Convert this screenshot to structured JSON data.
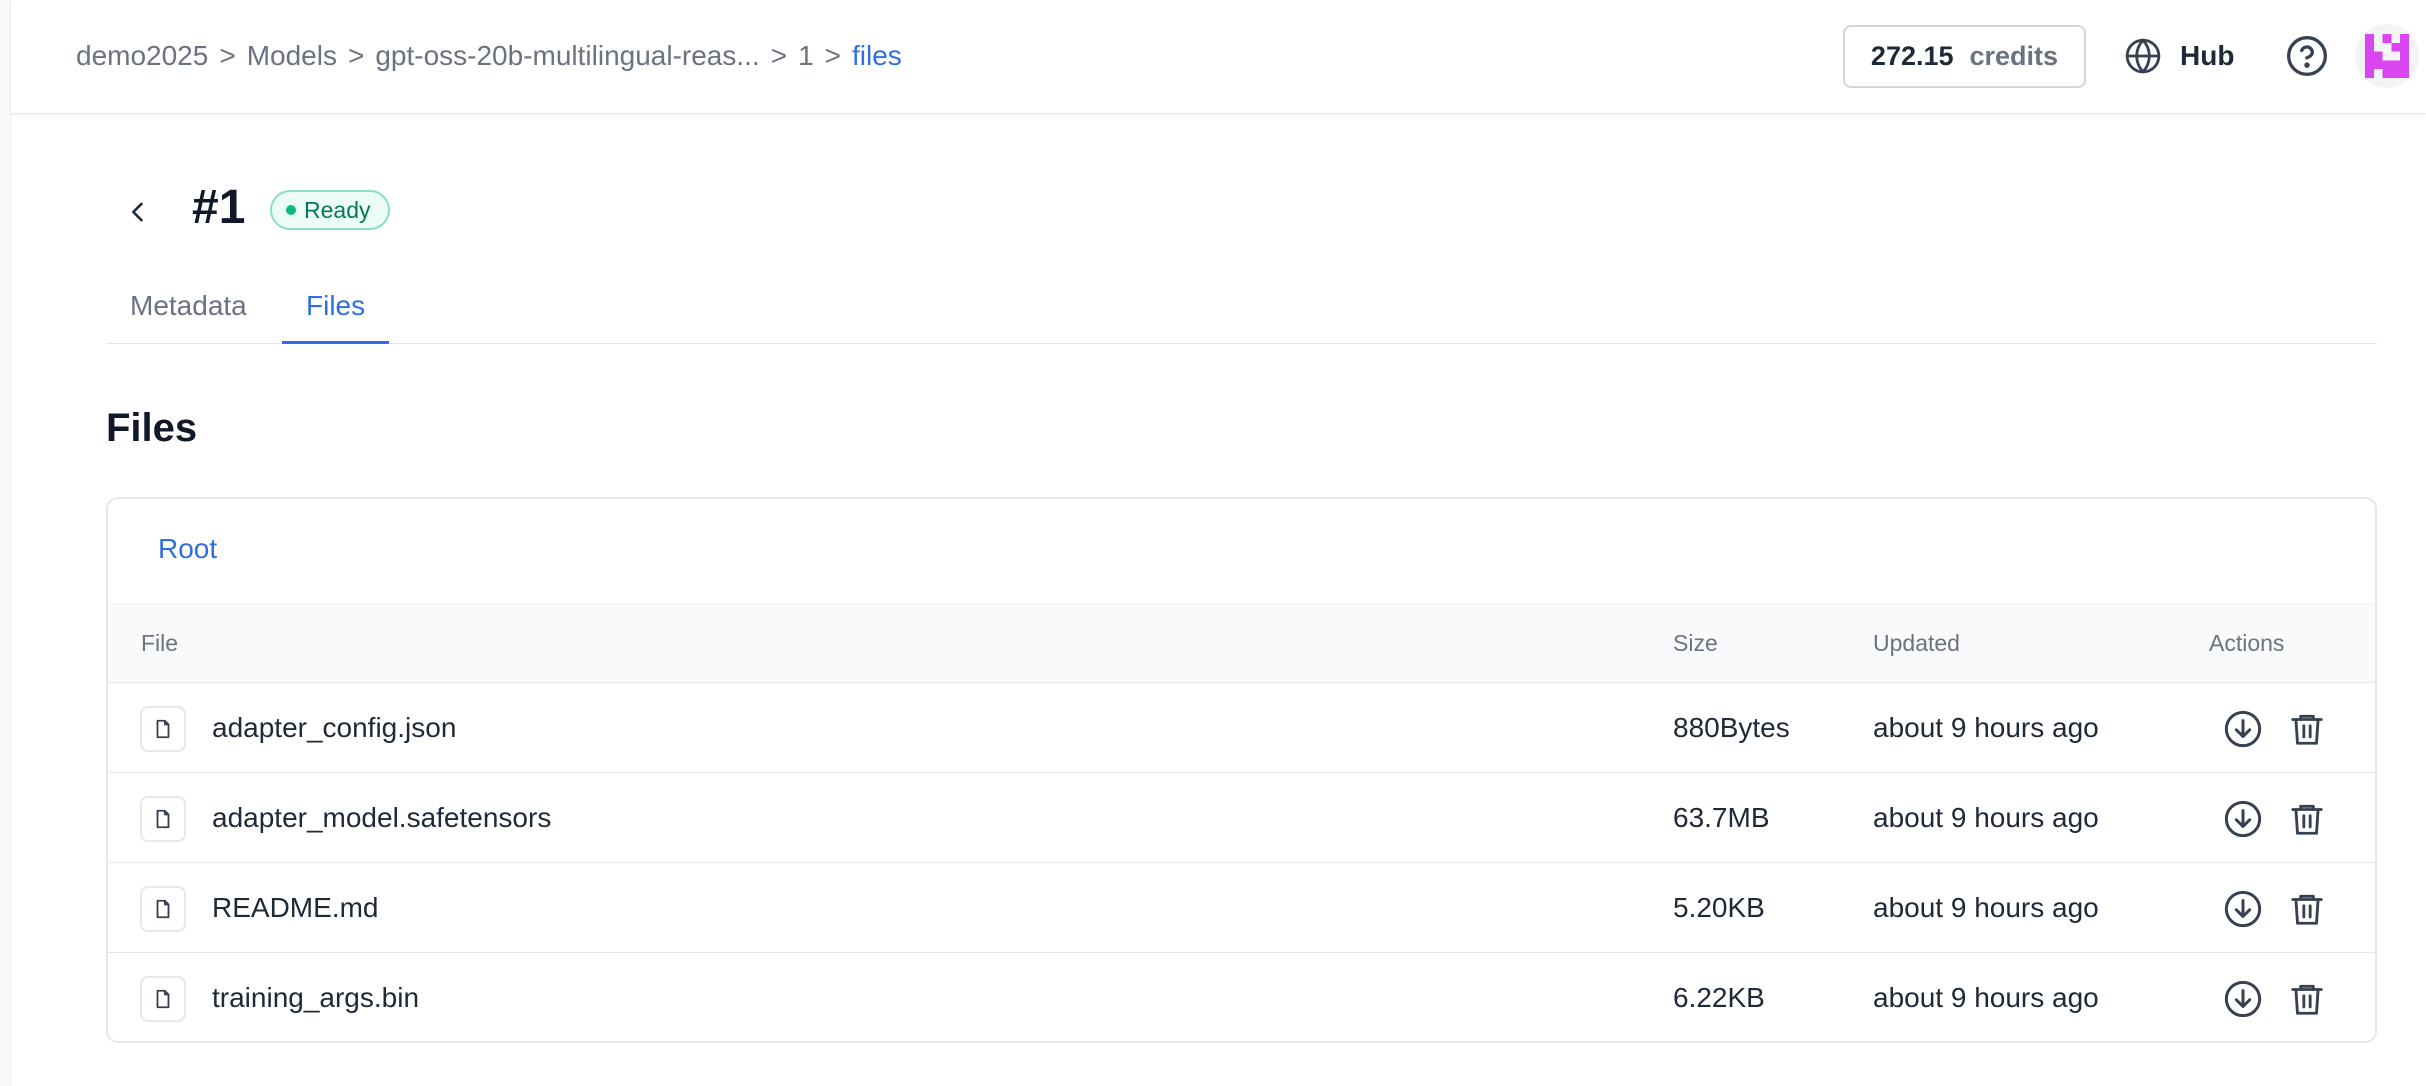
{
  "breadcrumb": {
    "items": [
      "demo2025",
      "Models",
      "gpt-oss-20b-multilingual-reas...",
      "1"
    ],
    "current": "files",
    "separator": ">"
  },
  "header": {
    "credits_amount": "272.15",
    "credits_unit": "credits",
    "hub_label": "Hub",
    "icons": [
      "globe-icon",
      "help-circle-icon",
      "avatar-identicon"
    ]
  },
  "page": {
    "title": "#1",
    "status": "Ready",
    "status_color": "#10b981"
  },
  "tabs": [
    {
      "label": "Metadata",
      "active": false
    },
    {
      "label": "Files",
      "active": true
    }
  ],
  "files_section": {
    "title": "Files",
    "root_label": "Root",
    "columns": {
      "file": "File",
      "size": "Size",
      "updated": "Updated",
      "actions": "Actions"
    },
    "rows": [
      {
        "name": "adapter_config.json",
        "size": "880Bytes",
        "updated": "about 9 hours ago"
      },
      {
        "name": "adapter_model.safetensors",
        "size": "63.7MB",
        "updated": "about 9 hours ago"
      },
      {
        "name": "README.md",
        "size": "5.20KB",
        "updated": "about 9 hours ago"
      },
      {
        "name": "training_args.bin",
        "size": "6.22KB",
        "updated": "about 9 hours ago"
      }
    ]
  },
  "colors": {
    "accent": "#2f6fe4",
    "avatar": "#d946ef"
  }
}
